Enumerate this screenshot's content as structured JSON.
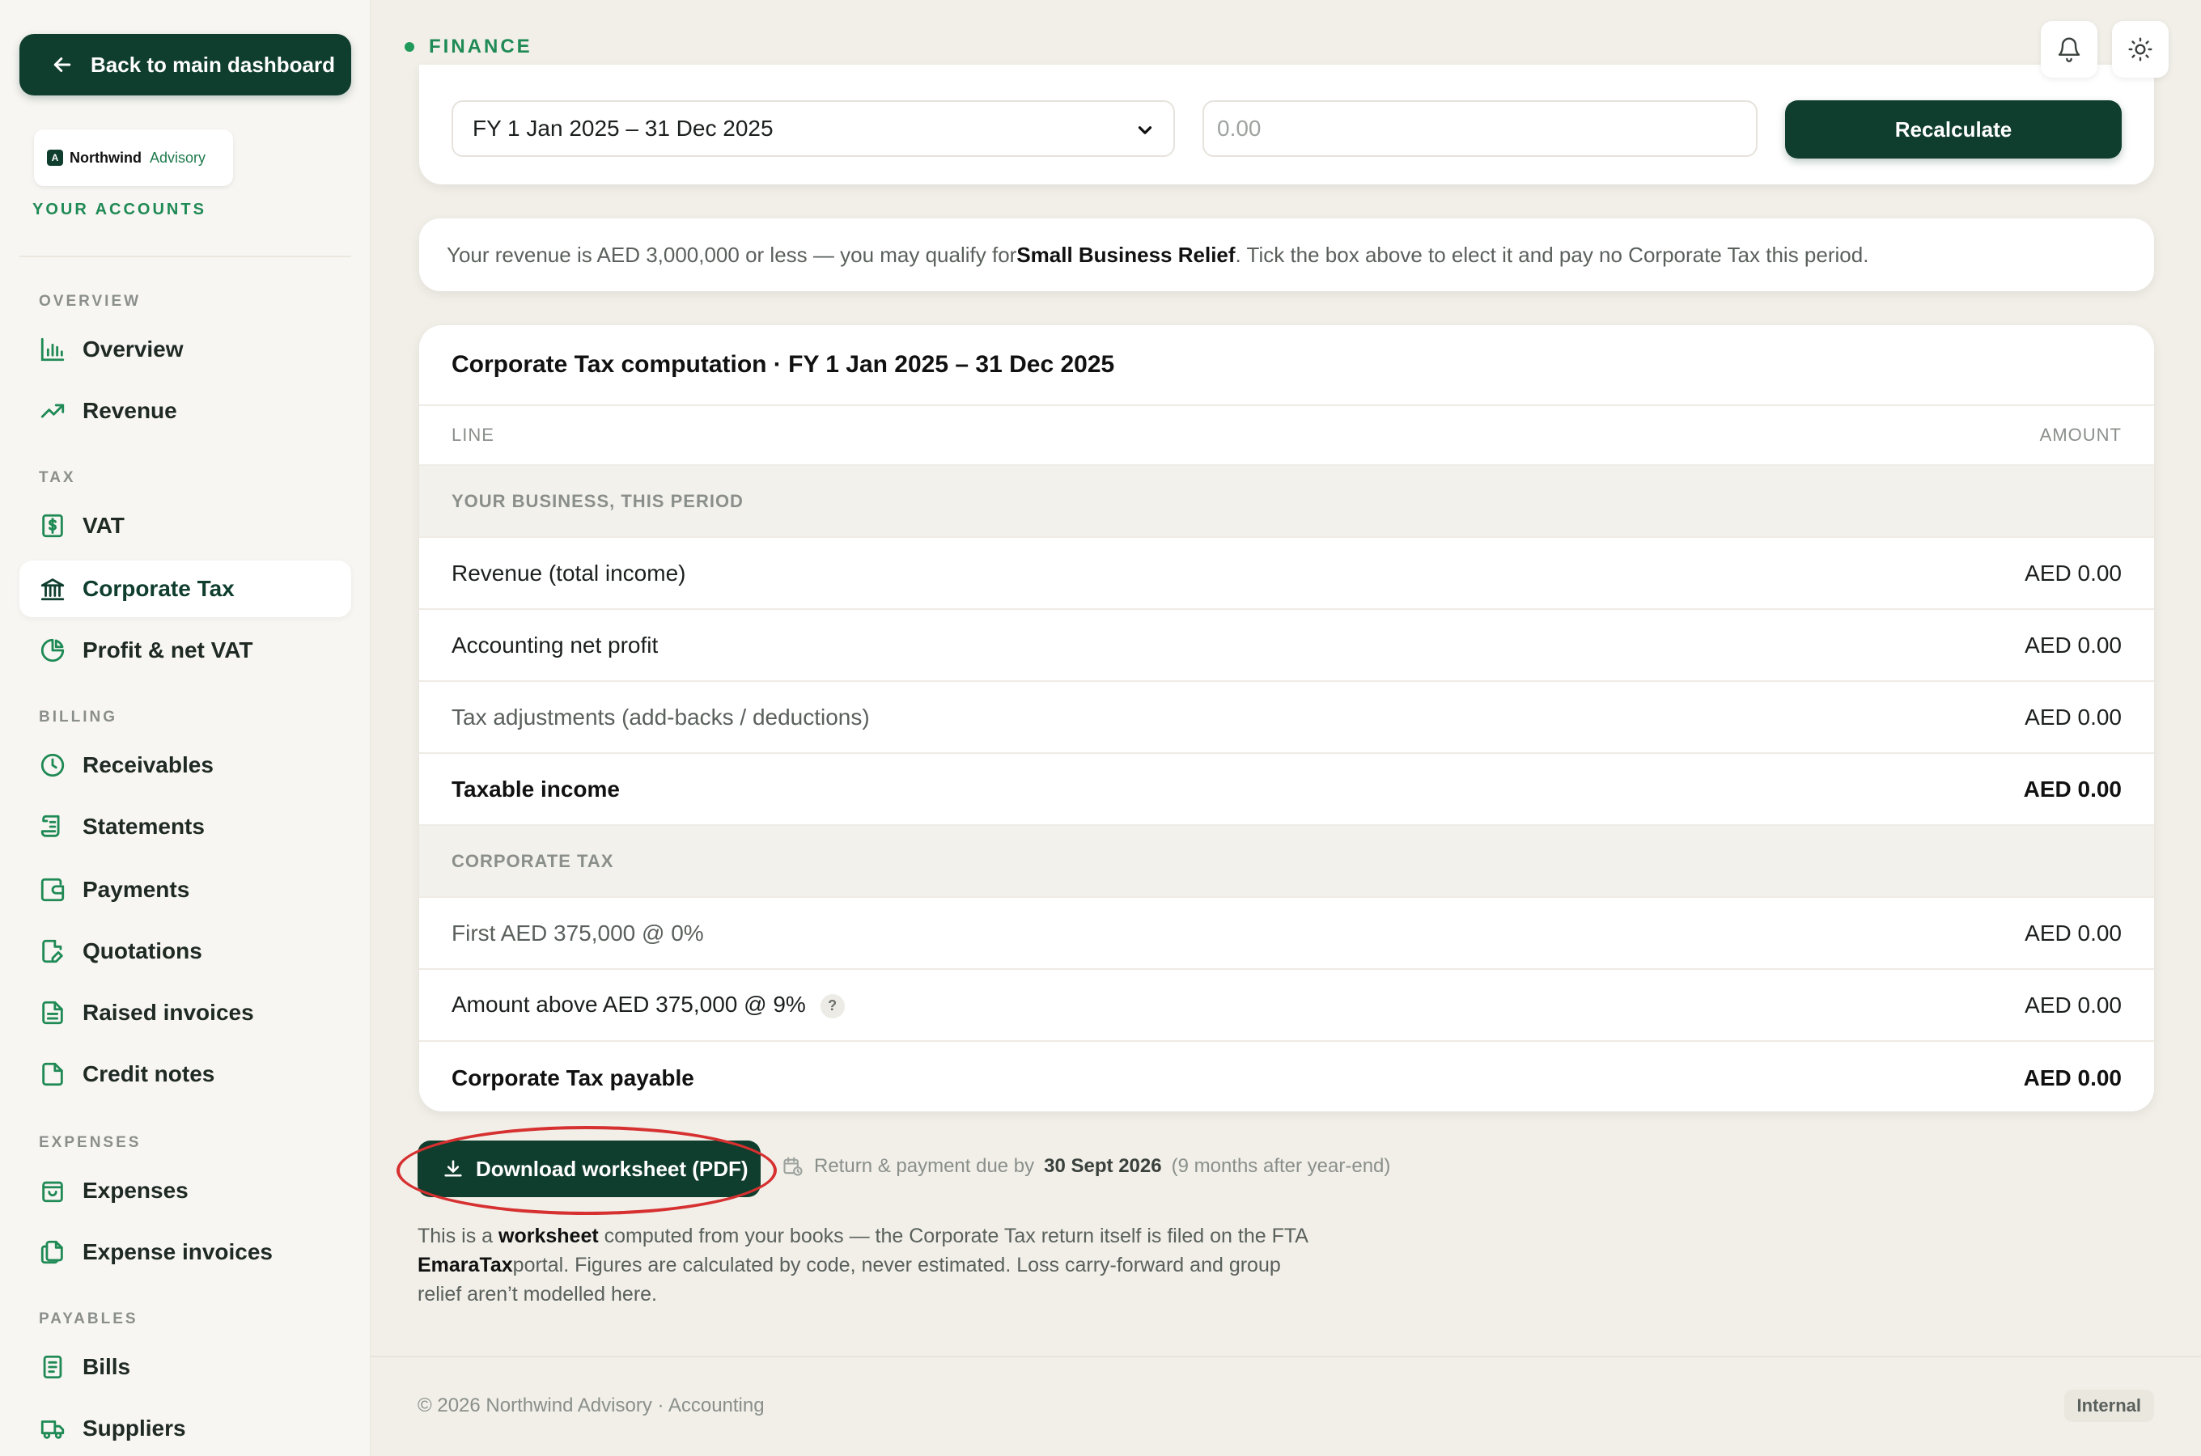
{
  "sidebar": {
    "back_label": "Back to main dashboard",
    "brand": {
      "name": "Northwind",
      "sub": "Advisory"
    },
    "your_accounts": "YOUR ACCOUNTS",
    "groups": {
      "overview": "OVERVIEW",
      "tax": "TAX",
      "billing": "BILLING",
      "expenses": "EXPENSES",
      "payables": "PAYABLES"
    },
    "items": {
      "overview": "Overview",
      "revenue": "Revenue",
      "vat": "VAT",
      "corporate_tax": "Corporate Tax",
      "profit_net_vat": "Profit & net VAT",
      "receivables": "Receivables",
      "statements": "Statements",
      "payments": "Payments",
      "quotations": "Quotations",
      "raised_invoices": "Raised invoices",
      "credit_notes": "Credit notes",
      "expenses": "Expenses",
      "expense_invoices": "Expense invoices",
      "bills": "Bills",
      "suppliers": "Suppliers"
    },
    "active_item": "Corporate Tax"
  },
  "header": {
    "section_label": "FINANCE",
    "icons": [
      "bell-icon",
      "sun-icon"
    ]
  },
  "filter": {
    "period_value": "FY 1 Jan 2025 – 31 Dec 2025",
    "amount_placeholder": "0.00",
    "recalculate_label": "Recalculate"
  },
  "notice": {
    "text_before": "Your revenue is AED 3,000,000 or less — you may qualify for ",
    "highlight": "Small Business Relief",
    "text_after": ". Tick the box above to elect it and pay no Corporate Tax this period."
  },
  "computation": {
    "title": "Corporate Tax computation · FY 1 Jan 2025 – 31 Dec 2025",
    "col_line": "LINE",
    "col_amount": "AMOUNT",
    "section_business": "YOUR BUSINESS, THIS PERIOD",
    "section_ct": "CORPORATE TAX",
    "rows": [
      {
        "label": "Revenue (total income)",
        "amount": "AED 0.00"
      },
      {
        "label": "Accounting net profit",
        "amount": "AED 0.00"
      },
      {
        "label": "Tax adjustments (add-backs / deductions)",
        "amount": "AED 0.00"
      },
      {
        "label": "Taxable income",
        "amount": "AED 0.00"
      },
      {
        "label": "First AED 375,000 @ 0%",
        "amount": "AED 0.00"
      },
      {
        "label": "Amount above AED 375,000 @ 9%",
        "amount": "AED 0.00",
        "help": "?"
      },
      {
        "label": "Corporate Tax payable",
        "amount": "AED 0.00"
      }
    ]
  },
  "actions": {
    "download_label": "Download worksheet (PDF)",
    "due_prefix": "Return & payment due by",
    "due_date": "30 Sept 2026",
    "due_suffix": "(9 months after year-end)"
  },
  "disclaimer": {
    "p1": "This is a ",
    "b1": "worksheet",
    "p2": " computed from your books — the Corporate Tax return itself is filed on the FTA ",
    "b2": "EmaraTax",
    "p3": "portal. Figures are calculated by code, never estimated. Loss carry-forward and group relief aren’t modelled here."
  },
  "footer": {
    "copyright": "© 2026 Northwind Advisory · Accounting",
    "badge": "Internal"
  },
  "colors": {
    "brand_dark": "#0f3d2e",
    "accent_green": "#1f8a55",
    "highlight_ring": "#d63030"
  }
}
